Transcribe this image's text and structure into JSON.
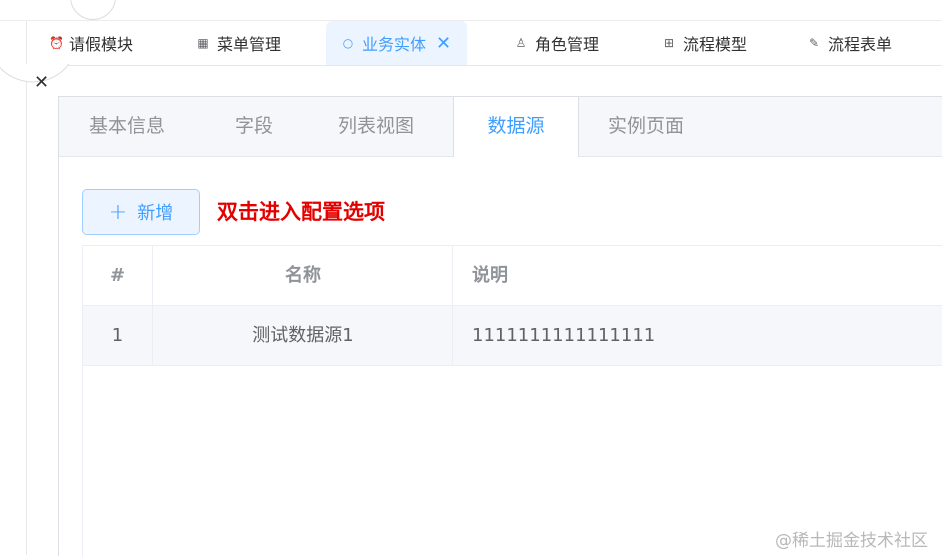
{
  "app_tabs": [
    {
      "label": "请假模块",
      "icon": "alarm-clock-icon"
    },
    {
      "label": "菜单管理",
      "icon": "grid-icon"
    },
    {
      "label": "业务实体",
      "icon": "refresh-icon",
      "active": true
    },
    {
      "label": "角色管理",
      "icon": "user-icon"
    },
    {
      "label": "流程模型",
      "icon": "org-chart-icon"
    },
    {
      "label": "流程表单",
      "icon": "edit-icon"
    }
  ],
  "inner_tabs": [
    {
      "label": "基本信息"
    },
    {
      "label": "字段"
    },
    {
      "label": "列表视图"
    },
    {
      "label": "数据源",
      "active": true
    },
    {
      "label": "实例页面"
    }
  ],
  "toolbar": {
    "add_label": "新增",
    "hint": "双击进入配置选项"
  },
  "table": {
    "columns": [
      "#",
      "名称",
      "说明"
    ],
    "rows": [
      [
        "1",
        "测试数据源1",
        "1111111111111111"
      ]
    ]
  },
  "watermark": "@稀土掘金技术社区",
  "colors": {
    "accent": "#409eff",
    "hint": "#e50000"
  }
}
